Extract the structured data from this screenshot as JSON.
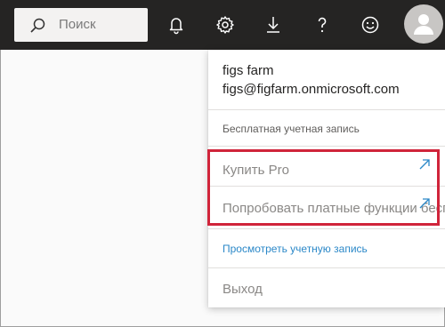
{
  "topbar": {
    "search_placeholder": "Поиск",
    "icons": [
      "notifications-icon",
      "settings-icon",
      "download-icon",
      "help-icon",
      "feedback-icon",
      "avatar-icon"
    ]
  },
  "account_menu": {
    "name": "figs farm",
    "email": "figs@figfarm.onmicrosoft.com",
    "plan": "Бесплатная учетная запись",
    "buy_pro": "Купить Pro",
    "try_paid": "Попробовать платные функции бесплатно",
    "view_account": "Просмотреть учетную запись",
    "logout": "Выход"
  },
  "colors": {
    "topbar": "#252423",
    "highlight": "#d0243a",
    "link": "#2b88c8"
  }
}
